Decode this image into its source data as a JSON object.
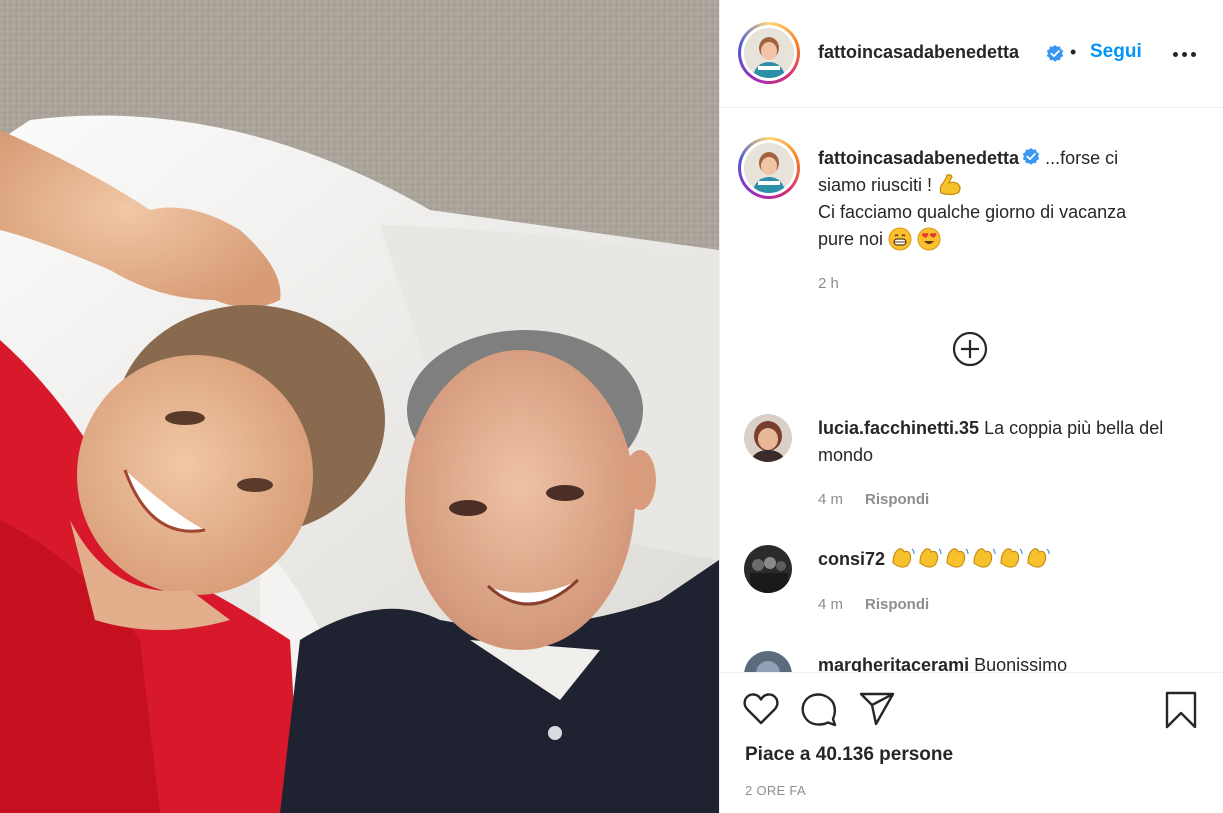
{
  "post": {
    "author": "fattoincasadabenedetta",
    "follow_label": "Segui",
    "separator": "•",
    "caption_lines": [
      "...forse ci",
      "siamo riusciti !",
      "Ci facciamo qualche giorno di vacanza",
      "pure noi"
    ],
    "caption_time": "2 h",
    "likes_text": "Piace a 40.136 persone",
    "date_text": "2 ORE FA"
  },
  "comments": [
    {
      "username": "lucia.facchinetti.35",
      "text": "La coppia più bella del mondo",
      "time": "4 m",
      "reply_label": "Rispondi"
    },
    {
      "username": "consi72",
      "text": "",
      "time": "4 m",
      "reply_label": "Rispondi"
    },
    {
      "username": "margheritacerami",
      "text": "Buonissimo"
    }
  ],
  "icons": {
    "header": [
      "verified-badge-icon",
      "more-options-icon"
    ],
    "caption": [
      "flexed-biceps-emoji",
      "grinning-emoji",
      "heart-eyes-emoji",
      "load-more-comments-icon"
    ],
    "comment_emoji": "waving-hand-emoji",
    "actions": [
      "heart-icon",
      "comment-icon",
      "share-icon",
      "bookmark-icon"
    ]
  },
  "colors": {
    "link_blue": "#0095f6",
    "verified_blue": "#3897f0",
    "text": "#262626",
    "muted": "#8e8e8e",
    "divider": "#efefef"
  }
}
